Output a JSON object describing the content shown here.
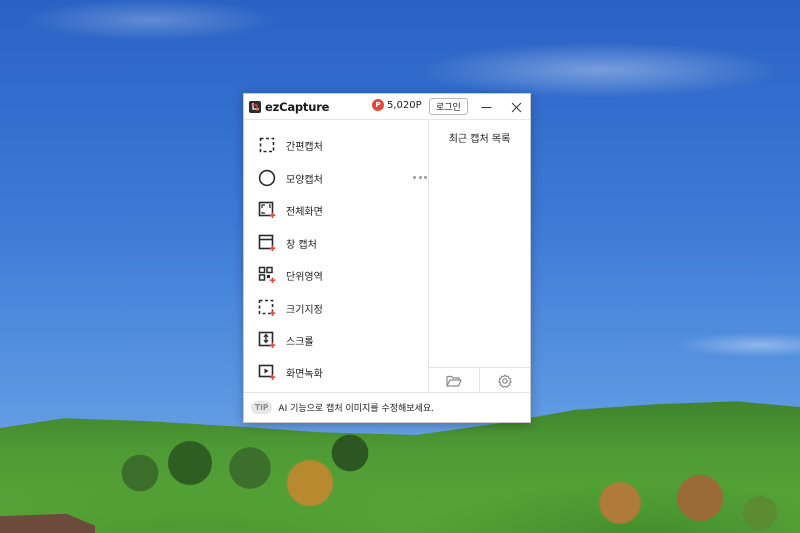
{
  "app": {
    "name": "ezCapture",
    "points": "5,020P",
    "points_badge": "P",
    "login_label": "로그인"
  },
  "menu": {
    "items": [
      {
        "label": "간편캡처",
        "icon": "dashed-rect-icon"
      },
      {
        "label": "모양캡처",
        "icon": "circle-icon"
      },
      {
        "label": "전체화면",
        "icon": "fullscreen-icon"
      },
      {
        "label": "창 캡처",
        "icon": "window-icon"
      },
      {
        "label": "단위영역",
        "icon": "grid-icon"
      },
      {
        "label": "크기지정",
        "icon": "size-rect-icon"
      },
      {
        "label": "스크롤",
        "icon": "scroll-icon"
      },
      {
        "label": "화면녹화",
        "icon": "record-icon"
      }
    ]
  },
  "recent": {
    "title": "최근 캡처 목록"
  },
  "tip": {
    "badge": "TIP",
    "text": "AI 기능으로 캡처 이미지를 수정해보세요."
  },
  "colors": {
    "accent": "#e6483c",
    "icon": "#2a2a2a"
  }
}
